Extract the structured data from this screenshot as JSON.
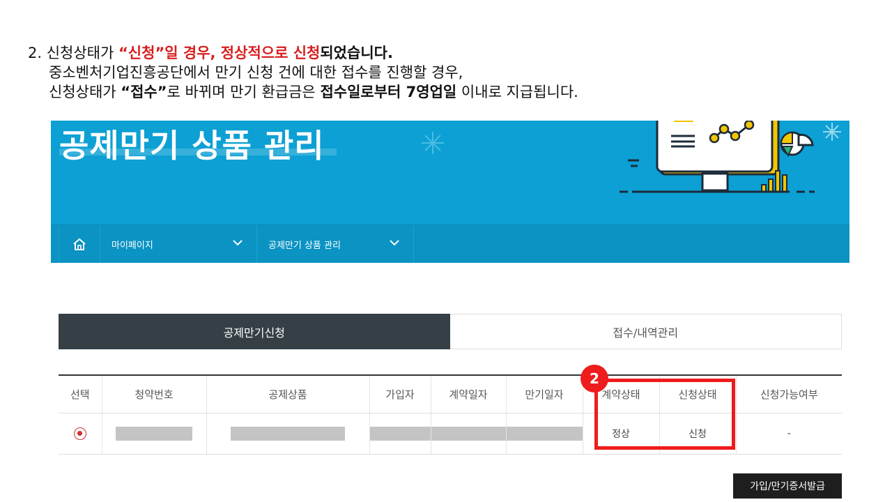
{
  "instruction": {
    "line1": {
      "prefix": "2. 신청상태가 ",
      "highlight": "“신청”일 경우, 정상적으로 신청",
      "suffix": "되었습니다."
    },
    "line2": "중소벤처기업진흥공단에서 만기 신청 건에 대한 접수를 진행할 경우,",
    "line3": {
      "a": "신청상태가 ",
      "b": "“접수”",
      "c": "로 바뀌며 만기 환급금은 ",
      "d": "접수일로부터 7영업일",
      "e": " 이내로 지급됩니다."
    }
  },
  "banner": {
    "title": "공제만기 상품 관리",
    "bg_color": "#0ca0d4"
  },
  "nav": {
    "home_icon": "home-icon",
    "items": [
      {
        "label": "마이페이지"
      },
      {
        "label": "공제만기 상품 관리"
      }
    ]
  },
  "tabs": [
    {
      "label": "공제만기신청",
      "active": true
    },
    {
      "label": "접수/내역관리",
      "active": false
    }
  ],
  "table": {
    "headers": [
      "선택",
      "청약번호",
      "공제상품",
      "가입자",
      "계약일자",
      "만기일자",
      "계약상태",
      "신청상태",
      "신청가능여부"
    ],
    "row": {
      "contract_status": "정상",
      "application_status": "신청",
      "available": "-"
    }
  },
  "annotation": {
    "badge": "2",
    "color": "#ee1c1c"
  },
  "buttons": {
    "issue_certificate": "가입/만기증서발급"
  }
}
